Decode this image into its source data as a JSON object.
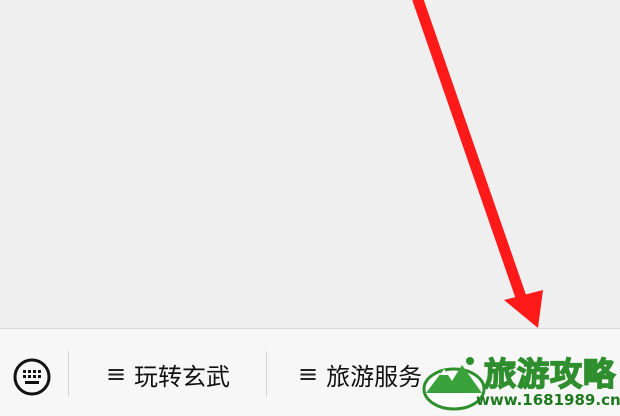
{
  "menu": {
    "keyboard_icon": "keyboard-icon",
    "items": [
      {
        "glyph": "≡",
        "label": "玩转玄武"
      },
      {
        "glyph": "≡",
        "label": "旅游服务"
      }
    ]
  },
  "watermark": {
    "title": "旅游攻略",
    "url": "www.1681989.cn"
  },
  "colors": {
    "background": "#efefef",
    "menu_bar": "#f7f7f7",
    "arrow": "#ff1a1a",
    "watermark_green": "#2f8f2f"
  }
}
